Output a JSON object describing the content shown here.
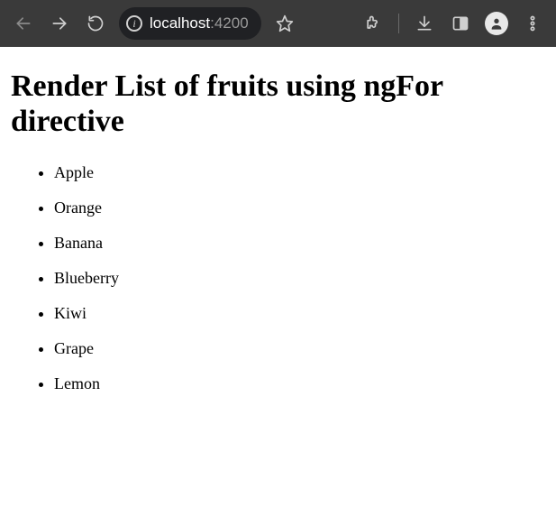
{
  "browser": {
    "address": {
      "host": "localhost",
      "port": ":4200"
    }
  },
  "page": {
    "heading": "Render List of fruits using ngFor directive",
    "fruits": [
      "Apple",
      "Orange",
      "Banana",
      "Blueberry",
      "Kiwi",
      "Grape",
      "Lemon"
    ]
  }
}
